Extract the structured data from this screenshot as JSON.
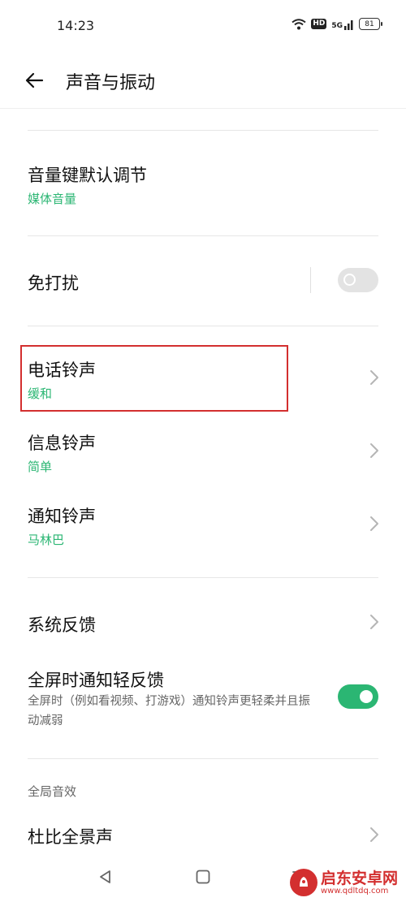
{
  "status_bar": {
    "time": "14:23",
    "hd_label": "HD",
    "network_label": "5G",
    "battery_level": "81"
  },
  "header": {
    "back_icon": "arrow-left-icon",
    "title": "声音与振动"
  },
  "settings": {
    "volume_key": {
      "title": "音量键默认调节",
      "value": "媒体音量"
    },
    "do_not_disturb": {
      "title": "免打扰",
      "enabled": false
    },
    "phone_ringtone": {
      "title": "电话铃声",
      "value": "缓和"
    },
    "message_ringtone": {
      "title": "信息铃声",
      "value": "简单"
    },
    "notification_ringtone": {
      "title": "通知铃声",
      "value": "马林巴"
    },
    "system_feedback": {
      "title": "系统反馈"
    },
    "fullscreen_feedback": {
      "title": "全屏时通知轻反馈",
      "description": "全屏时（例如看视频、打游戏）通知铃声更轻柔并且振动减弱",
      "enabled": true
    },
    "global_effects_section": "全局音效",
    "dolby_atmos": {
      "title": "杜比全景声"
    }
  },
  "nav_bar": {
    "back_icon": "triangle-back-icon",
    "home_icon": "square-home-icon",
    "recents_icon": "menu-lines-icon"
  },
  "watermark": {
    "name": "启东安卓网",
    "url": "www.qdltdq.com"
  },
  "colors": {
    "accent": "#2bb673",
    "highlight_border": "#d32f2f"
  }
}
